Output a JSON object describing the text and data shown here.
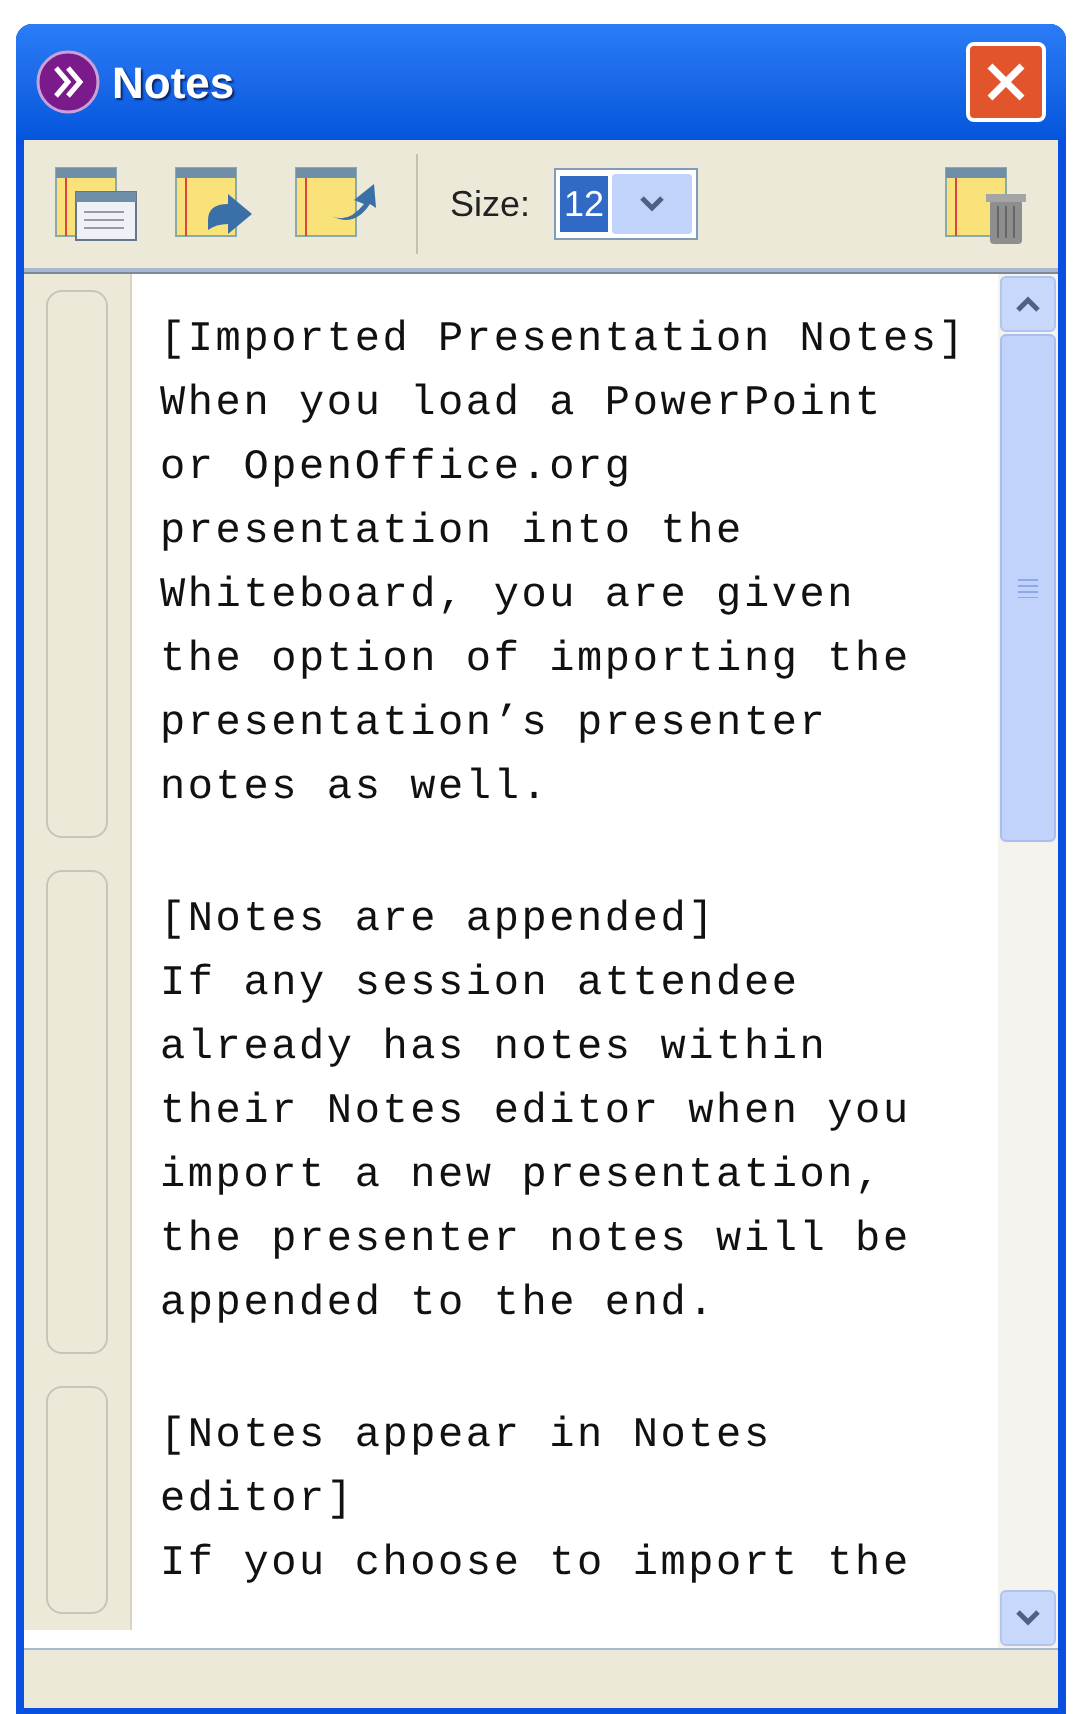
{
  "window": {
    "title": "Notes"
  },
  "toolbar": {
    "size_label": "Size:",
    "size_value": "12"
  },
  "notes": [
    {
      "lines": [
        "[Imported Presentation Notes]",
        "When you load a PowerPoint",
        "or OpenOffice.org",
        "presentation into the",
        "Whiteboard, you are given",
        "the option of importing the",
        "presentation’s presenter",
        "notes as well."
      ]
    },
    {
      "lines": [
        "[Notes are appended]",
        "If any session attendee",
        "already has notes within",
        "their Notes editor when you",
        "import a new presentation,",
        "the presenter notes will be",
        "appended to the end."
      ]
    },
    {
      "lines": [
        "[Notes appear in Notes",
        "editor]",
        "If you choose to import the"
      ]
    }
  ]
}
